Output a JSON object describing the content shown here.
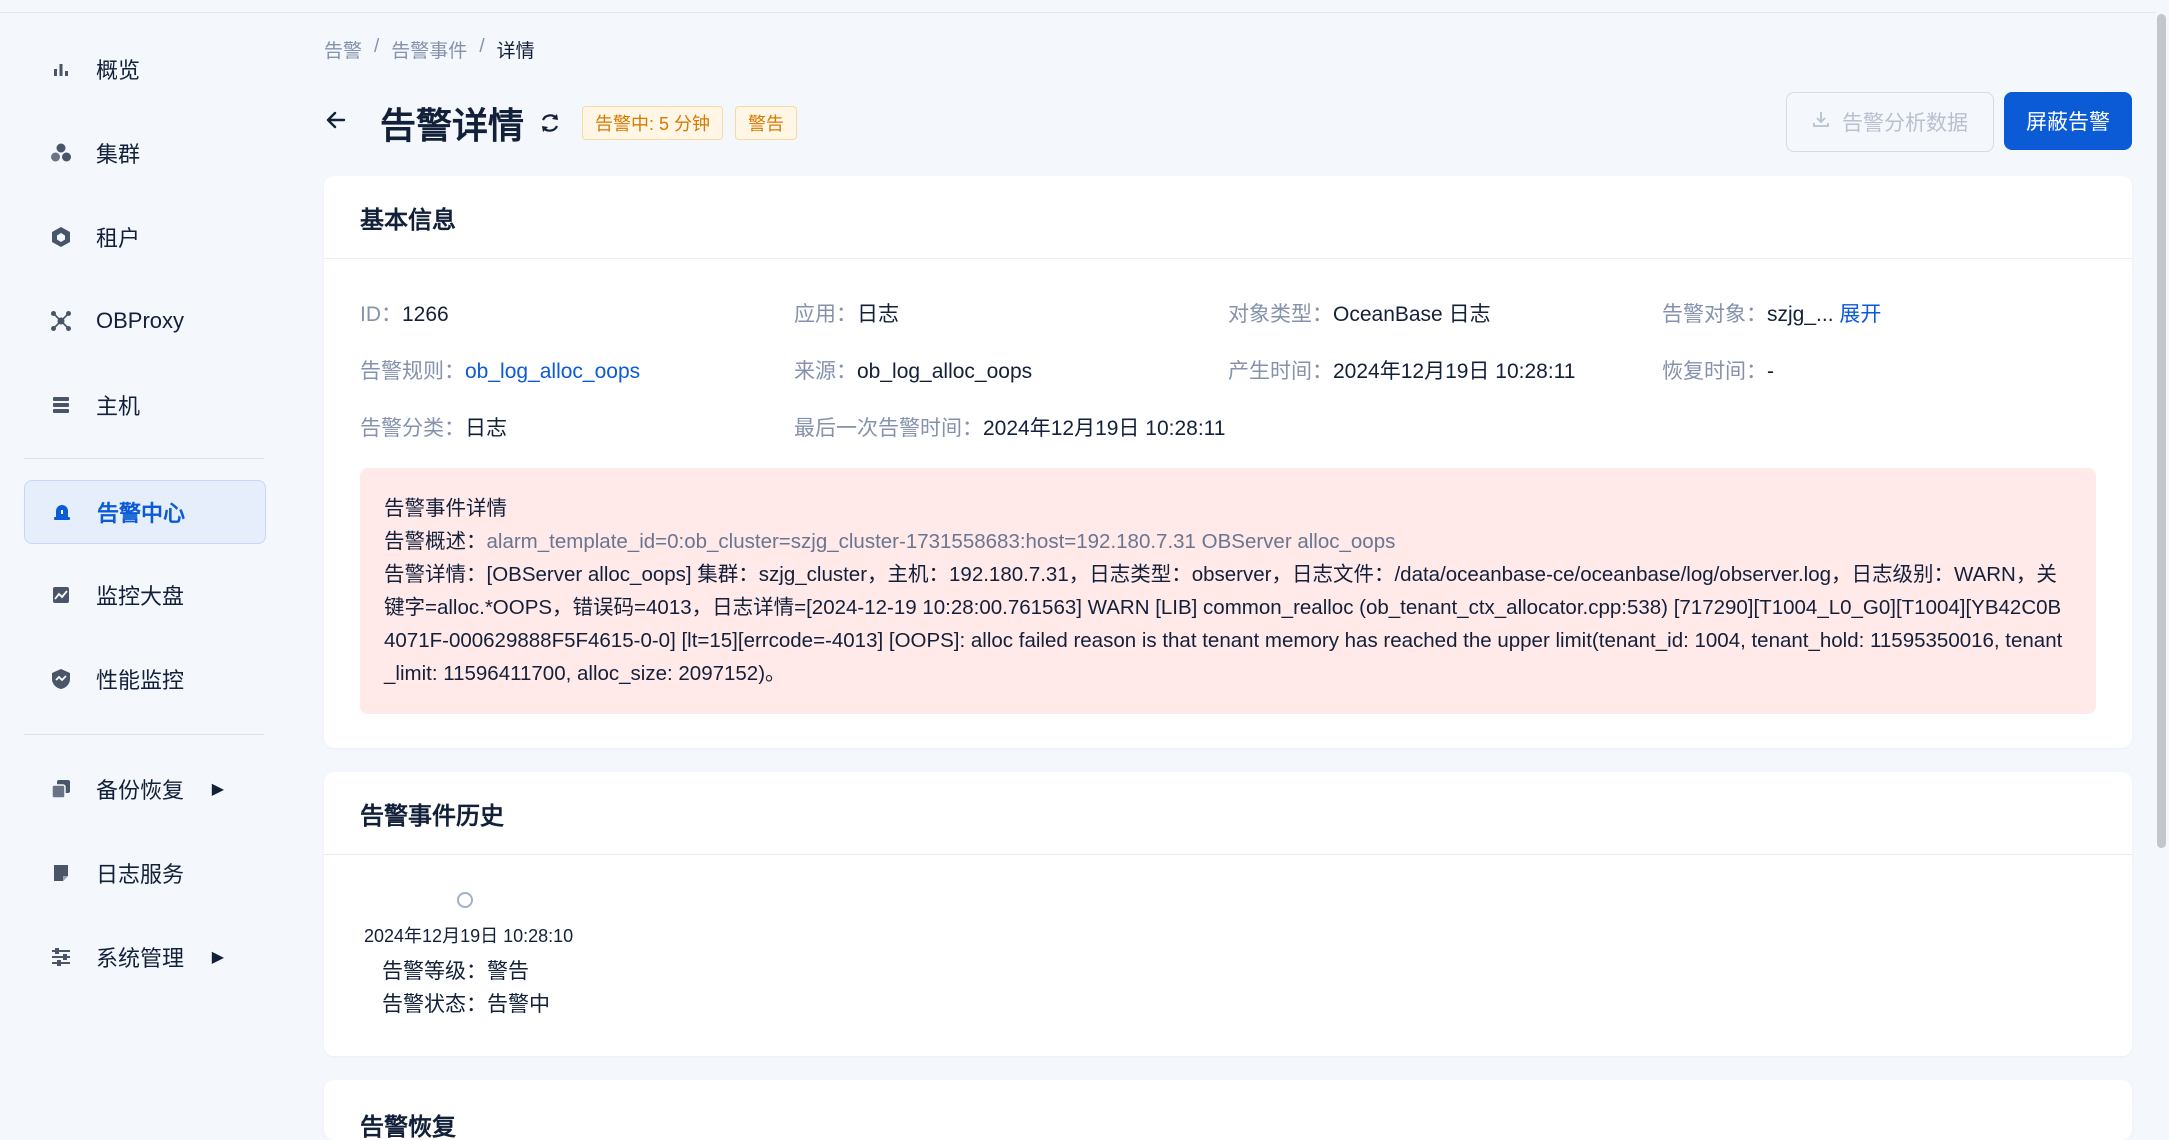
{
  "sidebar": {
    "items": [
      {
        "label": "概览",
        "icon": "bar-chart-icon"
      },
      {
        "label": "集群",
        "icon": "cluster-icon"
      },
      {
        "label": "租户",
        "icon": "tenant-icon"
      },
      {
        "label": "OBProxy",
        "icon": "proxy-icon"
      },
      {
        "label": "主机",
        "icon": "host-icon"
      },
      {
        "label": "告警中心",
        "icon": "alarm-icon",
        "active": true
      },
      {
        "label": "监控大盘",
        "icon": "monitor-icon"
      },
      {
        "label": "性能监控",
        "icon": "performance-icon"
      },
      {
        "label": "备份恢复",
        "icon": "backup-icon",
        "expandable": true
      },
      {
        "label": "日志服务",
        "icon": "log-icon"
      },
      {
        "label": "系统管理",
        "icon": "settings-icon",
        "expandable": true
      }
    ]
  },
  "breadcrumb": [
    "告警",
    "告警事件",
    "详情"
  ],
  "breadcrumb_sep": "/",
  "header": {
    "title": "告警详情",
    "status_tag": "告警中: 5 分钟",
    "level_tag": "警告",
    "export_button": "告警分析数据",
    "block_button": "屏蔽告警"
  },
  "basic_info": {
    "title": "基本信息",
    "fields": {
      "id": {
        "k": "ID：",
        "v": "1266"
      },
      "app": {
        "k": "应用：",
        "v": "日志"
      },
      "object_type": {
        "k": "对象类型：",
        "v": "OceanBase 日志"
      },
      "target": {
        "k": "告警对象：",
        "v": "szjg_...",
        "link": "展开"
      },
      "rule": {
        "k": "告警规则：",
        "v": "ob_log_alloc_oops"
      },
      "source": {
        "k": "来源：",
        "v": "ob_log_alloc_oops"
      },
      "created": {
        "k": "产生时间：",
        "v": "2024年12月19日 10:28:11"
      },
      "recovered": {
        "k": "恢复时间：",
        "v": "-"
      },
      "category": {
        "k": "告警分类：",
        "v": "日志"
      },
      "last_alarm": {
        "k": "最后一次告警时间：",
        "v": "2024年12月19日 10:28:11"
      }
    },
    "detail": {
      "heading": "告警事件详情",
      "summary_label": "告警概述：",
      "summary_value": "alarm_template_id=0:ob_cluster=szjg_cluster-1731558683:host=192.180.7.31 OBServer alloc_oops",
      "detail_label": "告警详情：",
      "detail_value": "[OBServer alloc_oops] 集群：szjg_cluster，主机：192.180.7.31，日志类型：observer，日志文件：/data/oceanbase-ce/oceanbase/log/observer.log，日志级别：WARN，关键字=alloc.*OOPS，错误码=4013，日志详情=[2024-12-19 10:28:00.761563] WARN [LIB] common_realloc (ob_tenant_ctx_allocator.cpp:538) [717290][T1004_L0_G0][T1004][YB42C0B4071F-000629888F5F4615-0-0] [lt=15][errcode=-4013] [OOPS]: alloc failed reason is that tenant memory has reached the upper limit(tenant_id: 1004, tenant_hold: 11595350016, tenant_limit: 11596411700, alloc_size: 2097152)。"
    }
  },
  "history": {
    "title": "告警事件历史",
    "time": "2024年12月19日 10:28:10",
    "level_label": "告警等级：",
    "level_value": "警告",
    "status_label": "告警状态：",
    "status_value": "告警中"
  },
  "next_card": {
    "title": "告警恢复"
  },
  "colors": {
    "primary": "#0b5bd6",
    "warning_tag_bg": "#fff6e6",
    "warning_tag_text": "#d67a00",
    "detail_bg": "#ffe9e9"
  }
}
